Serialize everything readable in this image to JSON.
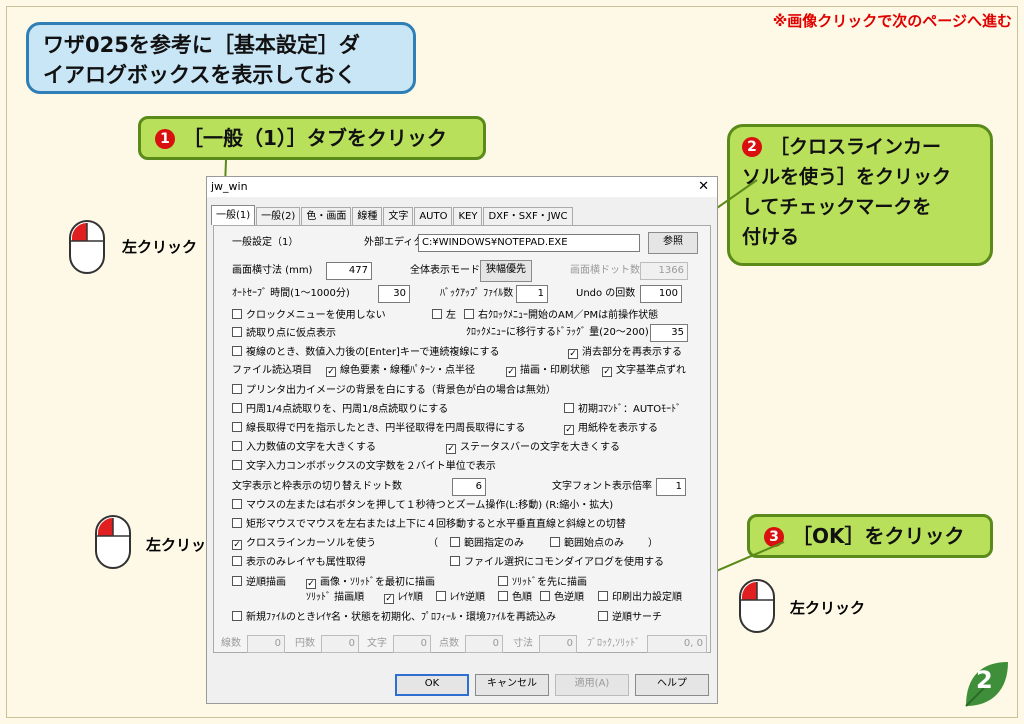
{
  "hint": "※画像クリックで次のページへ進む",
  "title_lines": [
    "ワザ025を参考に［基本設定］ダ",
    "イアログボックスを表示しておく"
  ],
  "callout1": {
    "num": "1",
    "text": "［一般（1）］タブをクリック"
  },
  "callout2": {
    "num": "2",
    "lines": [
      "［クロスラインカー",
      "ソルを使う］をクリック",
      "してチェックマークを",
      "付ける"
    ]
  },
  "callout3": {
    "num": "3",
    "text": "［OK］をクリック"
  },
  "mouse_label": "左クリック",
  "page_number": "2",
  "colors": {
    "accent_red": "#d81010",
    "callout_green": "#b9e05a",
    "title_blue": "#c9e6f6"
  },
  "dialog": {
    "title": "jw_win",
    "close": "✕",
    "tabs": [
      "一般(1)",
      "一般(2)",
      "色・画面",
      "線種",
      "文字",
      "AUTO",
      "KEY",
      "DXF・SXF・JWC"
    ],
    "section": "一般設定（1）",
    "editor_label": "外部エディタ",
    "editor_value": "C:¥WINDOWS¥NOTEPAD.EXE",
    "ref_button": "参照",
    "screen_size_label": "画面横寸法 (mm)",
    "screen_size_value": "477",
    "full_mode_label": "全体表示モード",
    "full_mode_button": "狭幅優先",
    "dots_label": "画面横ドット数",
    "dots_value": "1366",
    "autosave_label": "ｵｰﾄｾｰﾌﾞ 時間(1〜1000分)",
    "autosave_value": "30",
    "backup_label": "ﾊﾞｯｸｱｯﾌﾟ ﾌｧｲﾙ数",
    "backup_value": "1",
    "undo_label": "Undo の回数",
    "undo_value": "100",
    "clockmenu": "クロックメニューを使用しない",
    "left": "左",
    "right_clock": "右ｸﾛｯｸﾒﾆｭｰ開始のAM／PMは前操作状態",
    "read_temp": "読取り点に仮点表示",
    "drag_label": "ｸﾛｯｸﾒﾆｭｰに移行するﾄﾞﾗｯｸﾞ 量(20〜200)",
    "drag_value": "35",
    "multi_copy": "複線のとき、数値入力後の[Enter]キーで連続複線にする",
    "redraw_erase": "消去部分を再表示する",
    "file_read_label": "ファイル読込項目",
    "line_color": "線色要素・線種ﾊﾟﾀｰﾝ・点半径",
    "draw_print": "描画・印刷状態",
    "text_ref": "文字基準点ずれ",
    "printer_bg": "プリンタ出力イメージの背景を白にする（背景色が白の場合は無効）",
    "circle_read": "円周1/4点読取りを、円周1/8点読取りにする",
    "init_cmd": "初期ｺﾏﾝﾄﾞ：AUTOﾓｰﾄﾞ",
    "line_circle": "線長取得で円を指示したとき、円半径取得を円周長取得にする",
    "paper_frame": "用紙枠を表示する",
    "big_input": "入力数値の文字を大きくする",
    "big_status": "ステータスバーの文字を大きくする",
    "combo_2byte": "文字入力コンボボックスの文字数を２バイト単位で表示",
    "frame_dots_label": "文字表示と枠表示の切り替えドット数",
    "frame_dots_value": "6",
    "font_ratio_label": "文字フォント表示倍率",
    "font_ratio_value": "1",
    "zoom_hold": "マウスの左または右ボタンを押して１秒待つとズーム操作(L:移動) (R:縮小・拡大)",
    "wheel_move": "矩形マウスでマウスを左右または上下に４回移動すると水平垂直直線と斜線との切替",
    "crossline": "クロスラインカーソルを使う",
    "range_paren_open": "（",
    "range_specified": "範囲指定のみ",
    "range_start": "範囲始点のみ",
    "range_paren_close": "）",
    "layer_only": "表示のみレイヤも属性取得",
    "file_dialog": "ファイル選択にコモンダイアログを使用する",
    "reverse_draw": "逆順描画",
    "image_solid_first": "画像・ｿﾘｯﾄﾞを最初に描画",
    "solid_first": "ｿﾘｯﾄﾞを先に描画",
    "solid_order_label": "ｿﾘｯﾄﾞ 描画順",
    "layer_order": "ﾚｲﾔ順",
    "layer_reverse": "ﾚｲﾔ逆順",
    "color_order": "色順",
    "color_reverse": "色逆順",
    "print_setting": "印刷出力設定順",
    "new_file_init": "新規ﾌｧｲﾙのときﾚｲﾔ名・状態を初期化、ﾌﾟﾛﾌｨｰﾙ・環境ﾌｧｲﾙを再読込み",
    "reverse_search": "逆順サーチ",
    "stats": [
      {
        "label": "線数",
        "value": "0"
      },
      {
        "label": "円数",
        "value": "0"
      },
      {
        "label": "文字",
        "value": "0"
      },
      {
        "label": "点数",
        "value": "0"
      },
      {
        "label": "寸法",
        "value": "0"
      }
    ],
    "block_label": "ﾌﾞﾛｯｸ,ｿﾘｯﾄﾞ",
    "block_value": "0, 0",
    "ok": "OK",
    "cancel": "キャンセル",
    "apply": "適用(A)",
    "help": "ヘルプ"
  }
}
